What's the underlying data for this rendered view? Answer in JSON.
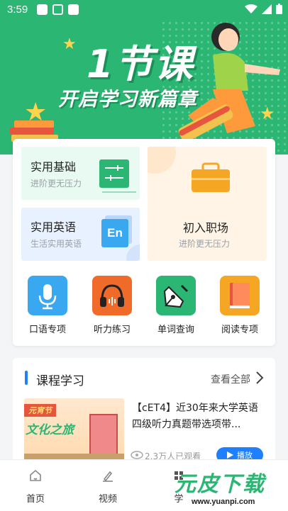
{
  "status": {
    "time": "3:59"
  },
  "banner": {
    "title": "1节课",
    "subtitle": "开启学习新篇章"
  },
  "tiles": [
    {
      "title": "实用基础",
      "subtitle": "进阶更无压力"
    },
    {
      "title": "实用英语",
      "subtitle": "生活实用英语",
      "icon_text": "En"
    },
    {
      "title": "初入职场",
      "subtitle": "进阶更无压力"
    }
  ],
  "quick_actions": [
    {
      "label": "口语专项",
      "icon": "microphone-icon",
      "color": "#3aa8f0"
    },
    {
      "label": "听力练习",
      "icon": "headphones-icon",
      "color": "#f06a2a"
    },
    {
      "label": "单词查询",
      "icon": "pen-nib-icon",
      "color": "#2bb673"
    },
    {
      "label": "阅读专项",
      "icon": "book-icon",
      "color": "#f5a623"
    }
  ],
  "course_section": {
    "heading": "课程学习",
    "more": "查看全部",
    "course": {
      "title": "【cET4】近30年来大学英语四级听力真题带选项带...",
      "views": "2.3万人已观看",
      "play": "播放",
      "thumb_tag": "元宵节",
      "thumb_text": "文化之旅"
    }
  },
  "tabbar": [
    {
      "label": "首页",
      "icon": "home-icon"
    },
    {
      "label": "视频",
      "icon": "video-icon"
    },
    {
      "label": "学",
      "icon": "study-icon"
    }
  ],
  "watermark": {
    "text": "元皮下载",
    "url": "www.yuanpi.com"
  }
}
